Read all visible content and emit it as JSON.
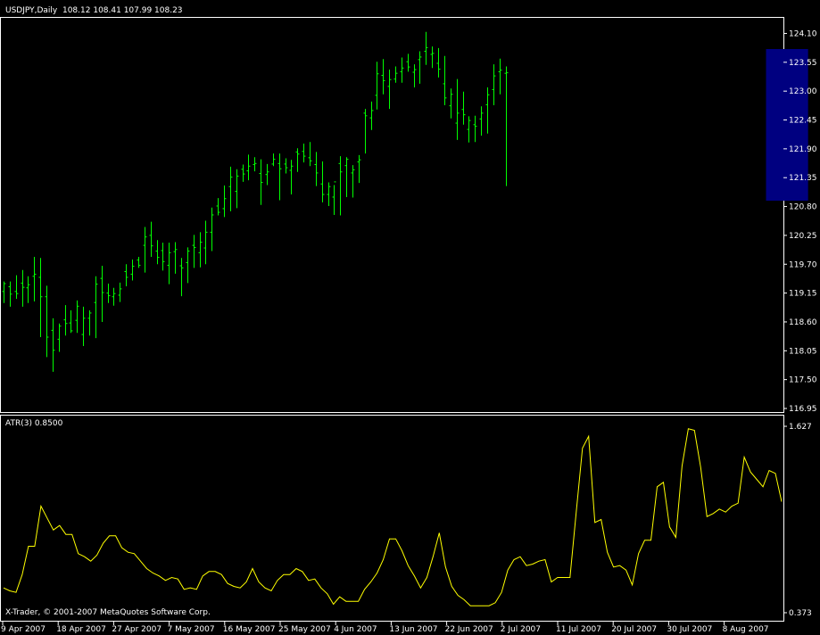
{
  "window": {
    "symbol_label": "USDJPY,Daily",
    "ohlc_label": "108.12 108.41 107.99 108.23",
    "indicator_label": "ATR(3) 0.8500",
    "copyright": "X-Trader, © 2001-2007 MetaQuotes Software Corp."
  },
  "colors": {
    "background": "#000000",
    "bars": "#00ff00",
    "atr_line": "#ffff00",
    "highlight": "#000080",
    "frame": "#ffffff"
  },
  "chart_data": [
    {
      "type": "ohlc",
      "ylim": [
        116.95,
        124.38
      ],
      "y_ticks": [
        "124.10",
        "123.55",
        "123.00",
        "122.45",
        "121.90",
        "121.35",
        "120.80",
        "120.25",
        "119.70",
        "119.15",
        "118.60",
        "118.05",
        "117.50",
        "116.95"
      ],
      "x_ticks": [
        "9 Apr 2007",
        "18 Apr 2007",
        "27 Apr 2007",
        "7 May 2007",
        "16 May 2007",
        "25 May 2007",
        "4 Jun 2007",
        "13 Jun 2007",
        "22 Jun 2007",
        "2 Jul 2007",
        "11 Jul 2007",
        "20 Jul 2007",
        "30 Jul 2007",
        "8 Aug 2007"
      ],
      "highlight_range": [
        125,
        131
      ],
      "series": [
        {
          "high": [
            119.37,
            119.37,
            119.49,
            119.59,
            119.47,
            119.84,
            119.82,
            119.29,
            118.67,
            118.57,
            118.92,
            118.82,
            119.01,
            118.89,
            118.82,
            119.47,
            119.67,
            119.33,
            119.25,
            119.35,
            119.7,
            119.79,
            119.84,
            120.41,
            120.51,
            120.16,
            120.11,
            120.11,
            120.12,
            119.82,
            120.02,
            120.26,
            120.31,
            120.53,
            120.78,
            120.96,
            121.2,
            121.56,
            121.51,
            121.6,
            121.79,
            121.74,
            121.7,
            121.61,
            121.81,
            121.81,
            121.72,
            121.69,
            121.91,
            122.0,
            122.03,
            121.84,
            121.66,
            121.26,
            121.21,
            121.76,
            121.74,
            121.59,
            121.78,
            122.66,
            122.8,
            123.56,
            123.61,
            123.41,
            123.47,
            123.64,
            123.71,
            123.51,
            123.76,
            124.13,
            123.85,
            123.82,
            123.67,
            123.05,
            123.23,
            122.99,
            122.52,
            122.53,
            122.71,
            123.07,
            123.51,
            123.62,
            123.47
          ],
          "low": [
            118.96,
            118.89,
            119.04,
            118.89,
            118.96,
            118.99,
            118.31,
            117.93,
            117.65,
            118.03,
            118.34,
            118.39,
            118.39,
            118.14,
            118.34,
            118.29,
            118.6,
            118.96,
            118.91,
            118.98,
            119.28,
            119.39,
            119.63,
            119.54,
            119.84,
            119.7,
            119.58,
            119.32,
            119.52,
            119.09,
            119.34,
            119.63,
            119.64,
            119.7,
            119.95,
            120.63,
            120.6,
            120.71,
            120.77,
            121.27,
            121.3,
            121.47,
            120.83,
            121.21,
            121.57,
            120.92,
            121.43,
            121.03,
            121.46,
            121.64,
            121.57,
            121.19,
            120.88,
            120.81,
            120.64,
            120.63,
            120.98,
            120.97,
            121.25,
            121.81,
            122.26,
            122.65,
            122.94,
            122.66,
            123.16,
            123.16,
            123.37,
            123.07,
            123.14,
            123.5,
            123.44,
            123.26,
            122.73,
            122.48,
            122.07,
            122.36,
            122.02,
            122.03,
            122.15,
            122.19,
            122.73,
            122.94,
            121.19
          ],
          "open": [
            119.18,
            119.27,
            119.18,
            119.34,
            119.25,
            119.47,
            119.45,
            119.08,
            118.44,
            118.27,
            118.64,
            118.58,
            118.63,
            118.36,
            118.67,
            118.97,
            119.43,
            119.15,
            119.08,
            119.11,
            119.56,
            119.51,
            119.78,
            120.06,
            120.25,
            119.95,
            119.96,
            119.68,
            119.94,
            119.67,
            119.73,
            120.06,
            119.92,
            120.01,
            120.31,
            120.81,
            120.76,
            121.18,
            121.09,
            121.51,
            121.48,
            121.6,
            121.43,
            121.41,
            121.61,
            121.62,
            121.61,
            121.49,
            121.84,
            121.85,
            121.73,
            121.6,
            121.23,
            121.03,
            120.98,
            121.62,
            121.58,
            121.44,
            121.65,
            122.58,
            122.49,
            122.92,
            123.3,
            123.09,
            123.23,
            123.37,
            123.56,
            123.36,
            123.6,
            123.76,
            123.7,
            123.53,
            123.14,
            122.72,
            122.39,
            122.65,
            122.27,
            122.36,
            122.47,
            122.74,
            123.03,
            123.37,
            123.34
          ],
          "close": [
            119.33,
            119.13,
            119.14,
            119.26,
            119.31,
            119.51,
            119.08,
            118.31,
            118.06,
            118.52,
            118.57,
            118.43,
            118.9,
            118.67,
            118.77,
            119.32,
            119.16,
            119.1,
            119.14,
            119.23,
            119.45,
            119.66,
            119.68,
            120.22,
            120.05,
            119.83,
            119.75,
            119.92,
            119.98,
            119.63,
            119.95,
            120.02,
            120.12,
            120.31,
            120.64,
            120.69,
            120.95,
            121.36,
            121.38,
            121.42,
            121.57,
            121.62,
            121.26,
            121.46,
            121.7,
            121.52,
            121.54,
            121.57,
            121.8,
            121.76,
            121.67,
            121.44,
            121.03,
            121.18,
            121.27,
            121.46,
            121.7,
            121.5,
            121.69,
            122.53,
            122.63,
            123.33,
            123.2,
            123.22,
            123.34,
            123.44,
            123.46,
            123.41,
            123.65,
            123.83,
            123.72,
            123.42,
            122.87,
            122.94,
            122.58,
            122.55,
            122.44,
            122.33,
            122.58,
            122.93,
            123.29,
            123.4,
            123.35
          ]
        }
      ]
    },
    {
      "type": "line",
      "title": "ATR(3) 0.8500",
      "ylim": [
        0.373,
        1.627
      ],
      "y_ticks": [
        "1.627",
        "0.373"
      ],
      "series": [
        {
          "name": "ATR(3)",
          "values": [
            0.54,
            0.52,
            0.51,
            0.63,
            0.82,
            0.82,
            1.09,
            1.01,
            0.93,
            0.96,
            0.9,
            0.9,
            0.77,
            0.75,
            0.72,
            0.76,
            0.84,
            0.89,
            0.89,
            0.81,
            0.78,
            0.77,
            0.72,
            0.67,
            0.64,
            0.62,
            0.59,
            0.61,
            0.6,
            0.53,
            0.54,
            0.53,
            0.62,
            0.65,
            0.65,
            0.63,
            0.57,
            0.55,
            0.54,
            0.58,
            0.67,
            0.58,
            0.54,
            0.52,
            0.59,
            0.63,
            0.63,
            0.67,
            0.65,
            0.59,
            0.6,
            0.54,
            0.5,
            0.43,
            0.48,
            0.45,
            0.45,
            0.45,
            0.53,
            0.58,
            0.64,
            0.73,
            0.87,
            0.87,
            0.79,
            0.69,
            0.62,
            0.54,
            0.61,
            0.75,
            0.91,
            0.68,
            0.55,
            0.49,
            0.46,
            0.42,
            0.42,
            0.42,
            0.42,
            0.44,
            0.51,
            0.66,
            0.73,
            0.75,
            0.69,
            0.7,
            0.72,
            0.73,
            0.58,
            0.61,
            0.61,
            0.61,
            1.05,
            1.48,
            1.56,
            0.98,
            1.0,
            0.78,
            0.68,
            0.69,
            0.66,
            0.56,
            0.77,
            0.86,
            0.86,
            1.22,
            1.25,
            0.95,
            0.88,
            1.36,
            1.61,
            1.6,
            1.35,
            1.02,
            1.04,
            1.07,
            1.05,
            1.09,
            1.11,
            1.42,
            1.32,
            1.27,
            1.22,
            1.33,
            1.31,
            1.12
          ]
        }
      ]
    }
  ]
}
